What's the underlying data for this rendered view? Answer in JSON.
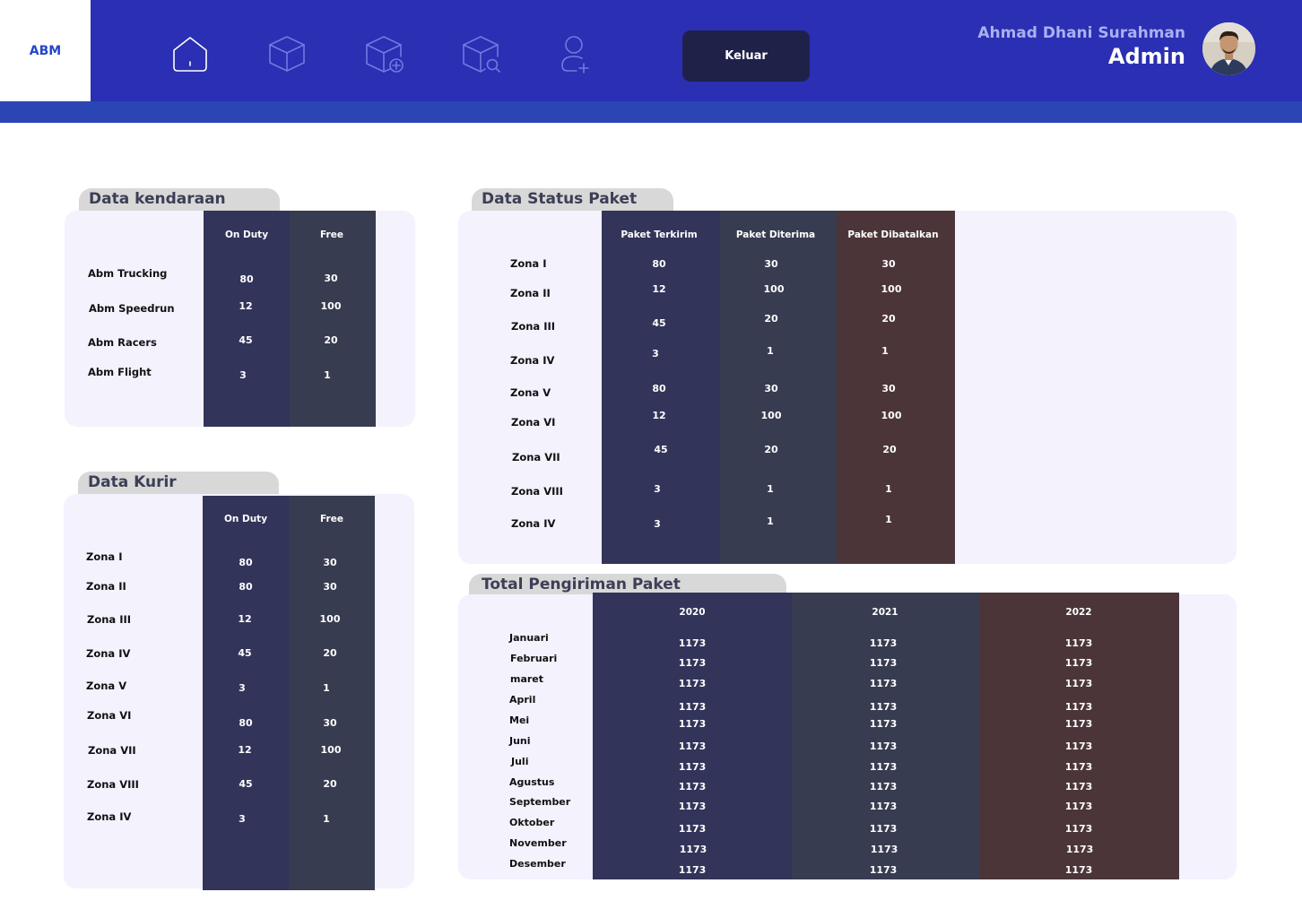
{
  "brand": {
    "logo": "ABM"
  },
  "nav": {
    "icons": [
      "home-icon",
      "package-icon",
      "add-package-icon",
      "search-package-icon",
      "add-user-icon"
    ],
    "logout_label": "Keluar"
  },
  "user": {
    "name": "Ahmad Dhani Surahman",
    "role": "Admin"
  },
  "vehicles": {
    "title": "Data kendaraan",
    "headers": [
      "On Duty",
      "Free"
    ],
    "rows": [
      {
        "label": "Abm Trucking",
        "on_duty": "80",
        "free": "30"
      },
      {
        "label": "Abm Speedrun",
        "on_duty": "12",
        "free": "100"
      },
      {
        "label": "Abm Racers",
        "on_duty": "45",
        "free": "20"
      },
      {
        "label": "Abm Flight",
        "on_duty": "3",
        "free": "1"
      }
    ]
  },
  "couriers": {
    "title": "Data Kurir",
    "headers": [
      "On Duty",
      "Free"
    ],
    "rows": [
      {
        "label": "Zona I",
        "on_duty": "80",
        "free": "30"
      },
      {
        "label": "Zona II",
        "on_duty": "80",
        "free": "30"
      },
      {
        "label": "Zona III",
        "on_duty": "12",
        "free": "100"
      },
      {
        "label": "Zona IV",
        "on_duty": "45",
        "free": "20"
      },
      {
        "label": "Zona V",
        "on_duty": "3",
        "free": "1"
      },
      {
        "label": "Zona VI",
        "on_duty": "80",
        "free": "30"
      },
      {
        "label": "Zona VII",
        "on_duty": "12",
        "free": "100"
      },
      {
        "label": "Zona VIII",
        "on_duty": "45",
        "free": "20"
      },
      {
        "label": "Zona IV",
        "on_duty": "3",
        "free": "1"
      }
    ]
  },
  "package_status": {
    "title": "Data Status Paket",
    "headers": [
      "Paket Terkirim",
      "Paket Diterima",
      "Paket Dibatalkan"
    ],
    "rows": [
      {
        "label": "Zona I",
        "sent": "80",
        "received": "30",
        "cancelled": "30"
      },
      {
        "label": "Zona II",
        "sent": "12",
        "received": "100",
        "cancelled": "100"
      },
      {
        "label": "Zona III",
        "sent": "45",
        "received": "20",
        "cancelled": "20"
      },
      {
        "label": "Zona IV",
        "sent": "3",
        "received": "1",
        "cancelled": "1"
      },
      {
        "label": "Zona V",
        "sent": "80",
        "received": "30",
        "cancelled": "30"
      },
      {
        "label": "Zona VI",
        "sent": "12",
        "received": "100",
        "cancelled": "100"
      },
      {
        "label": "Zona VII",
        "sent": "45",
        "received": "20",
        "cancelled": "20"
      },
      {
        "label": "Zona VIII",
        "sent": "3",
        "received": "1",
        "cancelled": "1"
      },
      {
        "label": "Zona IV",
        "sent": "3",
        "received": "1",
        "cancelled": "1"
      }
    ]
  },
  "shipments": {
    "title": "Total Pengiriman Paket",
    "headers": [
      "2020",
      "2021",
      "2022"
    ],
    "rows": [
      {
        "label": "Januari",
        "y2020": "1173",
        "y2021": "1173",
        "y2022": "1173"
      },
      {
        "label": "Februari",
        "y2020": "1173",
        "y2021": "1173",
        "y2022": "1173"
      },
      {
        "label": "maret",
        "y2020": "1173",
        "y2021": "1173",
        "y2022": "1173"
      },
      {
        "label": "April",
        "y2020": "1173",
        "y2021": "1173",
        "y2022": "1173"
      },
      {
        "label": "Mei",
        "y2020": "1173",
        "y2021": "1173",
        "y2022": "1173"
      },
      {
        "label": "Juni",
        "y2020": "1173",
        "y2021": "1173",
        "y2022": "1173"
      },
      {
        "label": "Juli",
        "y2020": "1173",
        "y2021": "1173",
        "y2022": "1173"
      },
      {
        "label": "Agustus",
        "y2020": "1173",
        "y2021": "1173",
        "y2022": "1173"
      },
      {
        "label": "September",
        "y2020": "1173",
        "y2021": "1173",
        "y2022": "1173"
      },
      {
        "label": "Oktober",
        "y2020": "1173",
        "y2021": "1173",
        "y2022": "1173"
      },
      {
        "label": "November",
        "y2020": "1173",
        "y2021": "1173",
        "y2022": "1173"
      },
      {
        "label": "Desember",
        "y2020": "1173",
        "y2021": "1173",
        "y2022": "1173"
      }
    ]
  },
  "colors": {
    "header_bg": "#2a2fb3",
    "logout_bg": "#1f2149",
    "panel_bg": "#f3f2fd",
    "col_navy": "#32345a",
    "col_slate": "#383c50",
    "col_brown": "#4b3538"
  }
}
